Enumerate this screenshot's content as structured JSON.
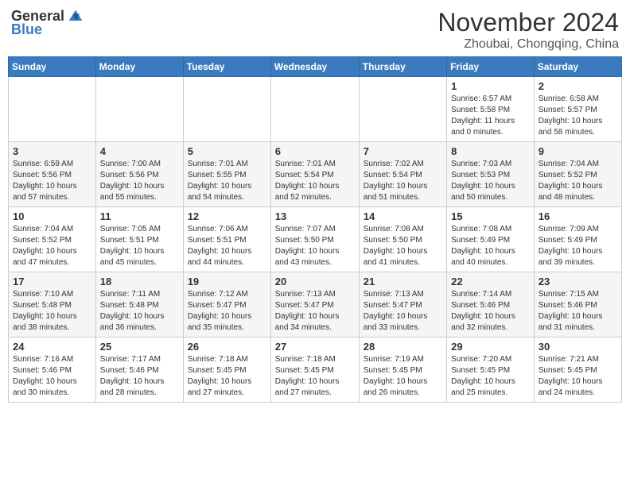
{
  "logo": {
    "general": "General",
    "blue": "Blue"
  },
  "title": "November 2024",
  "location": "Zhoubai, Chongqing, China",
  "weekdays": [
    "Sunday",
    "Monday",
    "Tuesday",
    "Wednesday",
    "Thursday",
    "Friday",
    "Saturday"
  ],
  "weeks": [
    [
      {
        "day": "",
        "info": ""
      },
      {
        "day": "",
        "info": ""
      },
      {
        "day": "",
        "info": ""
      },
      {
        "day": "",
        "info": ""
      },
      {
        "day": "",
        "info": ""
      },
      {
        "day": "1",
        "info": "Sunrise: 6:57 AM\nSunset: 5:58 PM\nDaylight: 11 hours and 0 minutes."
      },
      {
        "day": "2",
        "info": "Sunrise: 6:58 AM\nSunset: 5:57 PM\nDaylight: 10 hours and 58 minutes."
      }
    ],
    [
      {
        "day": "3",
        "info": "Sunrise: 6:59 AM\nSunset: 5:56 PM\nDaylight: 10 hours and 57 minutes."
      },
      {
        "day": "4",
        "info": "Sunrise: 7:00 AM\nSunset: 5:56 PM\nDaylight: 10 hours and 55 minutes."
      },
      {
        "day": "5",
        "info": "Sunrise: 7:01 AM\nSunset: 5:55 PM\nDaylight: 10 hours and 54 minutes."
      },
      {
        "day": "6",
        "info": "Sunrise: 7:01 AM\nSunset: 5:54 PM\nDaylight: 10 hours and 52 minutes."
      },
      {
        "day": "7",
        "info": "Sunrise: 7:02 AM\nSunset: 5:54 PM\nDaylight: 10 hours and 51 minutes."
      },
      {
        "day": "8",
        "info": "Sunrise: 7:03 AM\nSunset: 5:53 PM\nDaylight: 10 hours and 50 minutes."
      },
      {
        "day": "9",
        "info": "Sunrise: 7:04 AM\nSunset: 5:52 PM\nDaylight: 10 hours and 48 minutes."
      }
    ],
    [
      {
        "day": "10",
        "info": "Sunrise: 7:04 AM\nSunset: 5:52 PM\nDaylight: 10 hours and 47 minutes."
      },
      {
        "day": "11",
        "info": "Sunrise: 7:05 AM\nSunset: 5:51 PM\nDaylight: 10 hours and 45 minutes."
      },
      {
        "day": "12",
        "info": "Sunrise: 7:06 AM\nSunset: 5:51 PM\nDaylight: 10 hours and 44 minutes."
      },
      {
        "day": "13",
        "info": "Sunrise: 7:07 AM\nSunset: 5:50 PM\nDaylight: 10 hours and 43 minutes."
      },
      {
        "day": "14",
        "info": "Sunrise: 7:08 AM\nSunset: 5:50 PM\nDaylight: 10 hours and 41 minutes."
      },
      {
        "day": "15",
        "info": "Sunrise: 7:08 AM\nSunset: 5:49 PM\nDaylight: 10 hours and 40 minutes."
      },
      {
        "day": "16",
        "info": "Sunrise: 7:09 AM\nSunset: 5:49 PM\nDaylight: 10 hours and 39 minutes."
      }
    ],
    [
      {
        "day": "17",
        "info": "Sunrise: 7:10 AM\nSunset: 5:48 PM\nDaylight: 10 hours and 38 minutes."
      },
      {
        "day": "18",
        "info": "Sunrise: 7:11 AM\nSunset: 5:48 PM\nDaylight: 10 hours and 36 minutes."
      },
      {
        "day": "19",
        "info": "Sunrise: 7:12 AM\nSunset: 5:47 PM\nDaylight: 10 hours and 35 minutes."
      },
      {
        "day": "20",
        "info": "Sunrise: 7:13 AM\nSunset: 5:47 PM\nDaylight: 10 hours and 34 minutes."
      },
      {
        "day": "21",
        "info": "Sunrise: 7:13 AM\nSunset: 5:47 PM\nDaylight: 10 hours and 33 minutes."
      },
      {
        "day": "22",
        "info": "Sunrise: 7:14 AM\nSunset: 5:46 PM\nDaylight: 10 hours and 32 minutes."
      },
      {
        "day": "23",
        "info": "Sunrise: 7:15 AM\nSunset: 5:46 PM\nDaylight: 10 hours and 31 minutes."
      }
    ],
    [
      {
        "day": "24",
        "info": "Sunrise: 7:16 AM\nSunset: 5:46 PM\nDaylight: 10 hours and 30 minutes."
      },
      {
        "day": "25",
        "info": "Sunrise: 7:17 AM\nSunset: 5:46 PM\nDaylight: 10 hours and 28 minutes."
      },
      {
        "day": "26",
        "info": "Sunrise: 7:18 AM\nSunset: 5:45 PM\nDaylight: 10 hours and 27 minutes."
      },
      {
        "day": "27",
        "info": "Sunrise: 7:18 AM\nSunset: 5:45 PM\nDaylight: 10 hours and 27 minutes."
      },
      {
        "day": "28",
        "info": "Sunrise: 7:19 AM\nSunset: 5:45 PM\nDaylight: 10 hours and 26 minutes."
      },
      {
        "day": "29",
        "info": "Sunrise: 7:20 AM\nSunset: 5:45 PM\nDaylight: 10 hours and 25 minutes."
      },
      {
        "day": "30",
        "info": "Sunrise: 7:21 AM\nSunset: 5:45 PM\nDaylight: 10 hours and 24 minutes."
      }
    ]
  ]
}
